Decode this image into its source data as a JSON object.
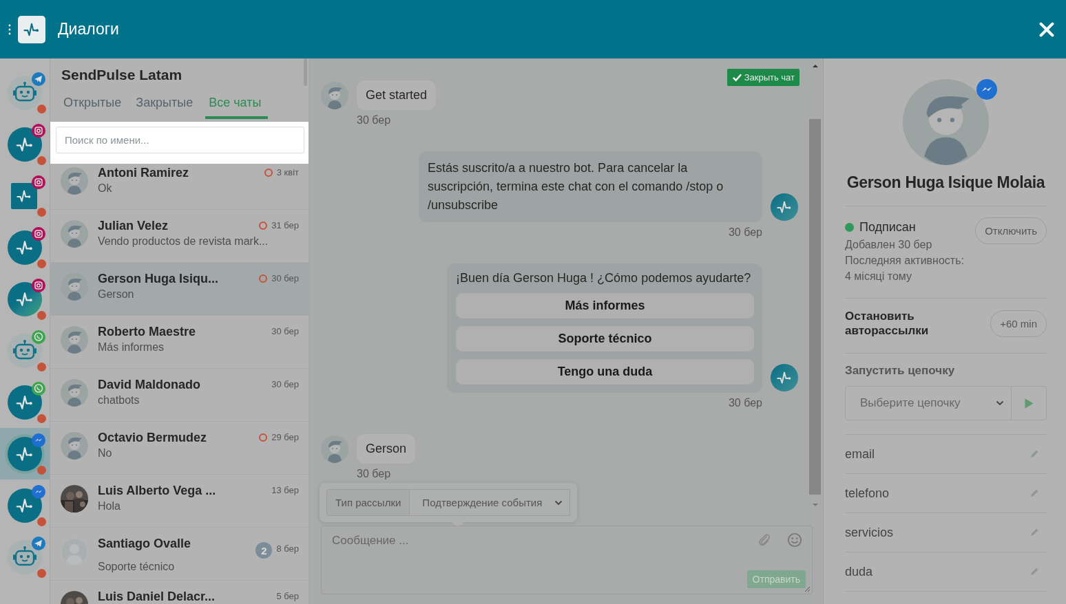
{
  "header": {
    "title": "Диалоги"
  },
  "bots": [
    {
      "kind": "robot",
      "badge": {
        "kind": "telegram"
      },
      "selected": false
    },
    {
      "kind": "pulse",
      "badge": {
        "kind": "instagram"
      },
      "selected": false
    },
    {
      "kind": "square",
      "badge": {
        "kind": "instagram"
      },
      "selected": false
    },
    {
      "kind": "pulse",
      "badge": {
        "kind": "instagram"
      },
      "selected": false
    },
    {
      "kind": "gradient",
      "badge": {
        "kind": "instagram"
      },
      "selected": false
    },
    {
      "kind": "robot",
      "badge": {
        "kind": "whatsapp"
      },
      "selected": false
    },
    {
      "kind": "pulse",
      "badge": {
        "kind": "whatsapp"
      },
      "selected": false
    },
    {
      "kind": "pulse",
      "badge": {
        "kind": "messenger"
      },
      "selected": true
    },
    {
      "kind": "pulse",
      "badge": {
        "kind": "messenger"
      },
      "selected": false
    },
    {
      "kind": "robot",
      "badge": {
        "kind": "telegram"
      },
      "selected": false
    }
  ],
  "inbox": {
    "title": "SendPulse Latam",
    "tabs": [
      {
        "label": "Открытые",
        "selected": false
      },
      {
        "label": "Закрытые",
        "selected": false
      },
      {
        "label": "Все чаты",
        "selected": true
      }
    ],
    "search": {
      "placeholder": "Поиск по имени..."
    }
  },
  "chats": [
    {
      "name": "Antoni Ramirez",
      "preview": "Ok",
      "date": "3 квіт",
      "unanswered": true,
      "kind": "default",
      "selected": false
    },
    {
      "name": "Julian Velez",
      "preview": "Vendo productos de revista mark...",
      "date": "31 бер",
      "unanswered": true,
      "kind": "default",
      "selected": false
    },
    {
      "name": "Gerson Huga Isiqu...",
      "preview": "Gerson",
      "date": "30 бер",
      "unanswered": true,
      "kind": "default",
      "selected": true
    },
    {
      "name": "Roberto Maestre",
      "preview": "Más informes",
      "date": "30 бер",
      "unanswered": false,
      "kind": "default",
      "selected": false
    },
    {
      "name": "David Maldonado",
      "preview": "chatbots",
      "date": "30 бер",
      "unanswered": false,
      "kind": "default",
      "selected": false
    },
    {
      "name": "Octavio Bermudez",
      "preview": "No",
      "date": "29 бер",
      "unanswered": true,
      "kind": "default",
      "selected": false
    },
    {
      "name": "Luis Alberto Vega ...",
      "preview": "Hola",
      "date": "13 бер",
      "unanswered": false,
      "selected": false
    },
    {
      "name": "Santiago Ovalle",
      "preview": "Soporte técnico",
      "date": "8 бер",
      "unanswered": false,
      "badge": "2",
      "kind": "blank",
      "selected": false
    },
    {
      "name": "Luis Daniel Delacr...",
      "date": "5 бер",
      "unanswered": false,
      "selected": false
    }
  ],
  "conversation": {
    "close_button": "Закрыть чат",
    "messages": [
      {
        "kind": "incoming",
        "text": "Get started",
        "time": "30 бер"
      },
      {
        "kind": "outgoing",
        "text": "Estás suscrito/a a nuestro bot. Para cancelar la suscripción, termina este chat con el comando /stop o /unsubscribe",
        "time": "30 бер"
      },
      {
        "kind": "buttons",
        "text": "¡Buen día Gerson Huga ! ¿Cómo podemos ayudarte?",
        "buttons": [
          "Más informes",
          "Soporte técnico",
          "Tengo una duda"
        ],
        "time": "30 бер"
      },
      {
        "kind": "incoming",
        "text": "Gerson",
        "time": "30 бер"
      }
    ],
    "mailing": {
      "label": "Тип рассылки",
      "value": "Подтверждение события"
    },
    "composer": {
      "placeholder": "Сообщение ...",
      "send_button": "Отправить"
    }
  },
  "contact": {
    "name": "Gerson Huga Isique Molaia",
    "badge": {
      "kind": "messenger"
    },
    "status": "Подписан",
    "subscribed": true,
    "unsubscribe_button": "Отключить",
    "added": "Добавлен 30 бер",
    "activity_label": "Последняя активность:",
    "activity": "4 місяці тому",
    "pause_label": "Остановить авторассылки",
    "pause_button": "+60 min",
    "flow_label": "Запустить цепочку",
    "flow_placeholder": "Выберите цепочку",
    "fields": [
      "email",
      "telefono",
      "servicios",
      "duda"
    ]
  }
}
